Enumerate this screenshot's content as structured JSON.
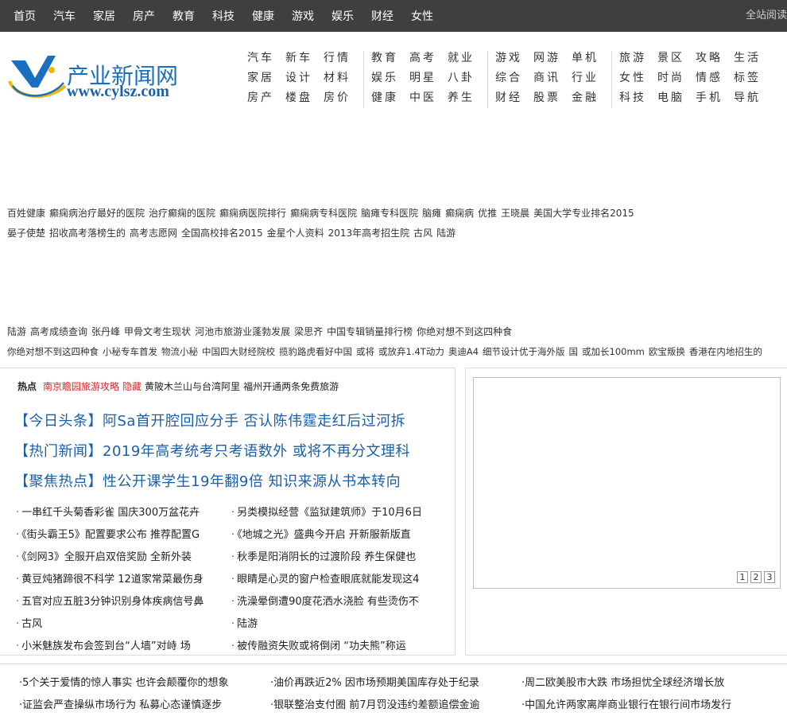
{
  "topnav": {
    "items": [
      "首页",
      "汽车",
      "家居",
      "房产",
      "教育",
      "科技",
      "健康",
      "游戏",
      "娱乐",
      "财经",
      "女性"
    ],
    "right_text": "全站阅读"
  },
  "logo": {
    "name_cn": "产业新闻网",
    "url": "www.cylsz.com"
  },
  "categories": [
    [
      [
        "汽车",
        "新车",
        "行情"
      ],
      [
        "家居",
        "设计",
        "材料"
      ],
      [
        "房产",
        "楼盘",
        "房价"
      ]
    ],
    [
      [
        "教育",
        "高考",
        "就业"
      ],
      [
        "娱乐",
        "明星",
        "八卦"
      ],
      [
        "健康",
        "中医",
        "养生"
      ]
    ],
    [
      [
        "游戏",
        "网游",
        "单机"
      ],
      [
        "综合",
        "商讯",
        "行业"
      ],
      [
        "财经",
        "股票",
        "金融"
      ]
    ],
    [
      [
        "旅游",
        "景区",
        "攻略",
        "生活"
      ],
      [
        "女性",
        "时尚",
        "情感",
        "标签"
      ],
      [
        "科技",
        "电脑",
        "手机",
        "导航"
      ]
    ]
  ],
  "tags_a": [
    [
      "百姓健康",
      "癫痫病治疗最好的医院",
      "治疗癫痫的医院",
      "癫痫病医院排行",
      "癫痫病专科医院",
      "脑瘫专科医院",
      "脑瘫",
      "癫痫病",
      "优推",
      "王晓晨",
      "美国大学专业排名2015"
    ],
    [
      "晏子使楚",
      "招收高考落榜生的",
      "高考志愿网",
      "全国高校排名2015",
      "金星个人资料",
      "2013年高考招生院",
      "古风",
      "陆游"
    ]
  ],
  "tags_b": [
    [
      "陆游",
      "高考成绩查询",
      "张丹峰",
      "甲骨文考生现状",
      "河池市旅游业蓬勃发展",
      "梁思齐",
      "中国专辑销量排行榜",
      "你绝对想不到这四种食"
    ],
    [
      "你绝对想不到这四种食",
      "小秘专车首发",
      "物流小秘",
      "中国四大财经院校",
      "揽豹路虎看好中国",
      "或将",
      "或放弃1.4T动力",
      "奥迪A4",
      "细节设计优于海外版",
      "国",
      "或加长100mm",
      "欧宝叛换",
      "香港在内地招生的"
    ]
  ],
  "hot": {
    "label": "热点",
    "red_items": [
      "南京瞻园旅游攻略",
      "隐藏"
    ],
    "items": [
      "黄陂木兰山与台湾阿里",
      "福州开通两条免费旅游"
    ]
  },
  "headlines": [
    "【今日头条】阿Sa首开腔回应分手 否认陈伟霆走红后过河拆",
    "【热门新闻】2019年高考统考只考语数外 或将不再分文理科",
    "【聚焦热点】性公开课学生19年翻9倍 知识来源从书本转向"
  ],
  "news_left": [
    "一串红千头菊香彩雀 国庆300万盆花卉",
    "《街头霸王5》配置要求公布 推荐配置G",
    "《剑网3》全服开启双倍奖励 全新外装",
    "黄豆炖猪蹄很不科学 12道家常菜最伤身",
    "五官对应五脏3分钟识别身体疾病信号鼻",
    "古风",
    "小米魅族发布会签到台“人墙”对峙 场"
  ],
  "news_right": [
    "另类模拟经营《监狱建筑师》于10月6日",
    "《地城之光》盛典今开启 开新服新版直",
    "秋季是阳消阴长的过渡阶段 养生保健也",
    "眼睛是心灵的窗户检查眼底就能发现这4",
    "洗澡晕倒遭90度花洒水浇脸 有些烫伤不",
    "陆游",
    "被传融资失败或将倒闭 “功夫熊”称运"
  ],
  "slider": {
    "pages": [
      "1",
      "2",
      "3"
    ]
  },
  "bottom_news": [
    [
      "5个关于爱情的惊人事实 也许会颠覆你的想象",
      "证监会严查操纵市场行为 私募心态谨慎逐步"
    ],
    [
      "油价再跌近2% 因市场预期美国库存处于纪录",
      "银联整治支付圈 前7月罚没违约差额追偿金逾"
    ],
    [
      "周二欧美股市大跌 市场担忧全球经济增长放",
      "中国允许两家离岸商业银行在银行间市场发行"
    ]
  ]
}
